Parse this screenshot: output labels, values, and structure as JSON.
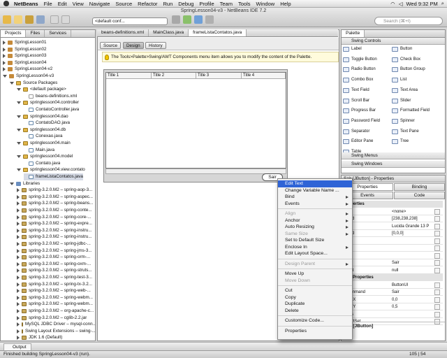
{
  "menubar": {
    "app": "NetBeans",
    "items": [
      "File",
      "Edit",
      "View",
      "Navigate",
      "Source",
      "Refactor",
      "Run",
      "Debug",
      "Profile",
      "Team",
      "Tools",
      "Window",
      "Help"
    ],
    "clock": "Wed 9:32 PM"
  },
  "window": {
    "title": "SpringLesson04-v3 - NetBeans IDE 7.2"
  },
  "toolbar": {
    "config": "<default conf...",
    "search_placeholder": "Search (⌘+I)"
  },
  "left_tabs": [
    "Projects",
    "Files",
    "Services"
  ],
  "tree": [
    {
      "text": "SpringLesson01",
      "depth": 0,
      "arrow": "r",
      "icon": "proj"
    },
    {
      "text": "SpringLesson02",
      "depth": 0,
      "arrow": "r",
      "icon": "proj"
    },
    {
      "text": "SpringLesson03",
      "depth": 0,
      "arrow": "r",
      "icon": "proj"
    },
    {
      "text": "SpringLesson04",
      "depth": 0,
      "arrow": "r",
      "icon": "proj"
    },
    {
      "text": "SpringLesson04-v2",
      "depth": 0,
      "arrow": "r",
      "icon": "proj"
    },
    {
      "text": "SpringLesson04-v3",
      "depth": 0,
      "arrow": "d",
      "icon": "proj"
    },
    {
      "text": "Source Packages",
      "depth": 1,
      "arrow": "d",
      "icon": "pkg"
    },
    {
      "text": "<default package>",
      "depth": 2,
      "arrow": "d",
      "icon": "pkg"
    },
    {
      "text": "beans-definitions.xml",
      "depth": 3,
      "arrow": "",
      "icon": "xml"
    },
    {
      "text": "springlesson04.controller",
      "depth": 2,
      "arrow": "d",
      "icon": "pkg"
    },
    {
      "text": "ContatoController.java",
      "depth": 3,
      "arrow": "",
      "icon": "java"
    },
    {
      "text": "springlesson04.dao",
      "depth": 2,
      "arrow": "d",
      "icon": "pkg"
    },
    {
      "text": "ContatoDAO.java",
      "depth": 3,
      "arrow": "",
      "icon": "java"
    },
    {
      "text": "springlesson04.db",
      "depth": 2,
      "arrow": "d",
      "icon": "pkg"
    },
    {
      "text": "Conexao.java",
      "depth": 3,
      "arrow": "",
      "icon": "java"
    },
    {
      "text": "springlesson04.main",
      "depth": 2,
      "arrow": "d",
      "icon": "pkg"
    },
    {
      "text": "Main.java",
      "depth": 3,
      "arrow": "",
      "icon": "java"
    },
    {
      "text": "springlesson04.model",
      "depth": 2,
      "arrow": "d",
      "icon": "pkg"
    },
    {
      "text": "Contato.java",
      "depth": 3,
      "arrow": "",
      "icon": "java"
    },
    {
      "text": "springlesson04.view.contato",
      "depth": 2,
      "arrow": "d",
      "icon": "pkg"
    },
    {
      "text": "frameListaContatos.java",
      "depth": 3,
      "arrow": "",
      "icon": "java"
    },
    {
      "text": "Libraries",
      "depth": 1,
      "arrow": "d",
      "icon": "lib"
    },
    {
      "text": "spring-3.2.0.M2 – spring-aop-3...",
      "depth": 2,
      "arrow": "r",
      "icon": "jar"
    },
    {
      "text": "spring-3.2.0.M2 – spring-aspec...",
      "depth": 2,
      "arrow": "r",
      "icon": "jar"
    },
    {
      "text": "spring-3.2.0.M2 – spring-beans...",
      "depth": 2,
      "arrow": "r",
      "icon": "jar"
    },
    {
      "text": "spring-3.2.0.M2 – spring-conte...",
      "depth": 2,
      "arrow": "r",
      "icon": "jar"
    },
    {
      "text": "spring-3.2.0.M2 – spring-core-...",
      "depth": 2,
      "arrow": "r",
      "icon": "jar"
    },
    {
      "text": "spring-3.2.0.M2 – spring-expre...",
      "depth": 2,
      "arrow": "r",
      "icon": "jar"
    },
    {
      "text": "spring-3.2.0.M2 – spring-instru...",
      "depth": 2,
      "arrow": "r",
      "icon": "jar"
    },
    {
      "text": "spring-3.2.0.M2 – spring-instru...",
      "depth": 2,
      "arrow": "r",
      "icon": "jar"
    },
    {
      "text": "spring-3.2.0.M2 – spring-jdbc-...",
      "depth": 2,
      "arrow": "r",
      "icon": "jar"
    },
    {
      "text": "spring-3.2.0.M2 – spring-jms-3...",
      "depth": 2,
      "arrow": "r",
      "icon": "jar"
    },
    {
      "text": "spring-3.2.0.M2 – spring-orm-...",
      "depth": 2,
      "arrow": "r",
      "icon": "jar"
    },
    {
      "text": "spring-3.2.0.M2 – spring-oxm-...",
      "depth": 2,
      "arrow": "r",
      "icon": "jar"
    },
    {
      "text": "spring-3.2.0.M2 – spring-struts...",
      "depth": 2,
      "arrow": "r",
      "icon": "jar"
    },
    {
      "text": "spring-3.2.0.M2 – spring-test-3...",
      "depth": 2,
      "arrow": "r",
      "icon": "jar"
    },
    {
      "text": "spring-3.2.0.M2 – spring-tx-3.2...",
      "depth": 2,
      "arrow": "r",
      "icon": "jar"
    },
    {
      "text": "spring-3.2.0.M2 – spring-web-...",
      "depth": 2,
      "arrow": "r",
      "icon": "jar"
    },
    {
      "text": "spring-3.2.0.M2 – spring-webm...",
      "depth": 2,
      "arrow": "r",
      "icon": "jar"
    },
    {
      "text": "spring-3.2.0.M2 – spring-webm...",
      "depth": 2,
      "arrow": "r",
      "icon": "jar"
    },
    {
      "text": "spring-3.2.0.M2 – org-apache-c...",
      "depth": 2,
      "arrow": "r",
      "icon": "jar"
    },
    {
      "text": "spring-3.2.0.M2 – cglib-2.2.jar",
      "depth": 2,
      "arrow": "r",
      "icon": "jar"
    },
    {
      "text": "MySQL JDBC Driver – mysql-conn...",
      "depth": 2,
      "arrow": "r",
      "icon": "jar"
    },
    {
      "text": "Swing Layout Extensions – swing-...",
      "depth": 2,
      "arrow": "r",
      "icon": "jar"
    },
    {
      "text": "JDK 1.6 (Default)",
      "depth": 2,
      "arrow": "r",
      "icon": "jar"
    }
  ],
  "editor_tabs": [
    "beans-definitions.xml",
    "MainClass.java",
    "frameListaContatos.java"
  ],
  "design_tabs": [
    "Source",
    "Design",
    "History"
  ],
  "info_message": "The Tools>Palette>Swing/AWT Components menu item allows you to modify the content of the Palette.",
  "table_columns": [
    "Title 1",
    "Title 2",
    "Title 3",
    "Title 4"
  ],
  "sair_button": "Sair",
  "palette": {
    "title": "Palette",
    "swing_controls": "Swing Controls",
    "items": [
      "Label",
      "Button",
      "Toggle Button",
      "Check Box",
      "Radio Button",
      "Button Group",
      "Combo Box",
      "List",
      "Text Field",
      "Text Area",
      "Scroll Bar",
      "Slider",
      "Progress Bar",
      "Formatted Field",
      "Password Field",
      "Spinner",
      "Separator",
      "Text Pane",
      "Editor Pane",
      "Tree",
      "Table"
    ],
    "swing_menus": "Swing Menus",
    "swing_windows": "Swing Windows"
  },
  "properties": {
    "title": "Sair [JButton] - Properties",
    "tabs": [
      "Properties",
      "Binding",
      "Events",
      "Code"
    ],
    "section1": "Properties",
    "rows": [
      {
        "name": "n",
        "value": "<none>"
      },
      {
        "name": "round",
        "value": "[238,238,238]"
      },
      {
        "name": "",
        "value": "Lucida Grande 13 P"
      },
      {
        "name": "round",
        "value": "[0,0,0]"
      },
      {
        "name": "",
        "value": ""
      },
      {
        "name": "",
        "value": ""
      },
      {
        "name": "onic",
        "value": ""
      },
      {
        "name": "",
        "value": "Sair"
      },
      {
        "name": "pText",
        "value": "null"
      }
    ],
    "section2": "ther Properties",
    "rows2": [
      {
        "name": "ssID",
        "value": "ButtonUI"
      },
      {
        "name": "nCommand",
        "value": "Sair"
      },
      {
        "name": "mentX",
        "value": "0,0"
      },
      {
        "name": "mentY",
        "value": "0,5"
      },
      {
        "name": "crolls",
        "value": ""
      },
      {
        "name": "roundSet",
        "value": ""
      }
    ],
    "footer": "on1 [JButton]"
  },
  "context_menu": [
    {
      "label": "Edit Text",
      "state": "hi"
    },
    {
      "label": "Change Variable Name ...",
      "state": ""
    },
    {
      "label": "Bind",
      "state": "",
      "sub": true
    },
    {
      "label": "Events",
      "state": "",
      "sub": true
    },
    {
      "sep": true
    },
    {
      "label": "Align",
      "state": "dis",
      "sub": true
    },
    {
      "label": "Anchor",
      "state": "",
      "sub": true
    },
    {
      "label": "Auto Resizing",
      "state": "",
      "sub": true
    },
    {
      "label": "Same Size",
      "state": "dis",
      "sub": true
    },
    {
      "label": "Set to Default Size",
      "state": ""
    },
    {
      "label": "Enclose In",
      "state": "",
      "sub": true
    },
    {
      "label": "Edit Layout Space...",
      "state": ""
    },
    {
      "sep": true
    },
    {
      "label": "Design Parent",
      "state": "dis",
      "sub": true
    },
    {
      "sep": true
    },
    {
      "label": "Move Up",
      "state": ""
    },
    {
      "label": "Move Down",
      "state": "dis"
    },
    {
      "sep": true
    },
    {
      "label": "Cut",
      "state": ""
    },
    {
      "label": "Copy",
      "state": ""
    },
    {
      "label": "Duplicate",
      "state": ""
    },
    {
      "label": "Delete",
      "state": ""
    },
    {
      "sep": true
    },
    {
      "label": "Customize Code...",
      "state": ""
    },
    {
      "sep": true
    },
    {
      "label": "Properties",
      "state": ""
    }
  ],
  "status": {
    "output_tab": "Output",
    "message": "Finished building SpringLesson04-v3 (run).",
    "position": "105 | 54"
  }
}
